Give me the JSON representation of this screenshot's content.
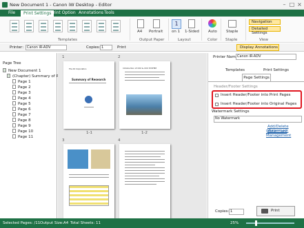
{
  "window": {
    "title": "New Document 1 - Canon iW Desktop - Editor"
  },
  "tabs": [
    "File",
    "Print Settings",
    "Print Option",
    "Annotations",
    "Tools"
  ],
  "ribbon": {
    "templates_label": "Templates",
    "output_paper_label": "Output Paper",
    "layout_label": "Layout",
    "color_label": "Color",
    "staple_label": "Staple",
    "view_label": "View",
    "paper_size": "A4",
    "orientation": "Portrait",
    "pages_per_sheet": "1",
    "on_label": "on 1",
    "sided": "1-Sided",
    "color_mode": "Auto",
    "staple": "Staple",
    "navigation": "Navigation",
    "detailed_settings": "Detailed Settings",
    "display_annotations": "Display Annotations"
  },
  "toolbar": {
    "printer_label": "Printer:",
    "printer_value": "Canon iR-ADV",
    "copies_label": "Copies:",
    "copies_value": "1",
    "print_label": "Print"
  },
  "left": {
    "title": "Page Tree",
    "root": "New Document 1",
    "chapter": "(Chapter) Summary of R",
    "pages": [
      "Page 1",
      "Page 2",
      "Page 3",
      "Page 4",
      "Page 5",
      "Page 6",
      "Page 7",
      "Page 8",
      "Page 9",
      "Page 10",
      "Page 11"
    ]
  },
  "pages": {
    "p1_label": "1-1",
    "p2_label": "1-2",
    "p3_label": "3",
    "p4_label": "4",
    "p1_heading": "Summary of Research",
    "p1_company": "The XX Corporation",
    "p2_heading": "Introduction of XXX & XXX SYSTEM"
  },
  "right": {
    "printer_name_label": "Printer Name:",
    "printer_name_value": "Canon iR-ADV",
    "tabs": [
      "Templates",
      "Print Settings",
      "Page Settings"
    ],
    "header_footer_label": "Header/Footer Settings",
    "insert_print": "Insert Header/Footer into Print Pages",
    "insert_original": "Insert Header/Footer into Original Pages",
    "watermark_label": "Watermark Settings",
    "watermark_value": "No Watermark",
    "add_delete": "Add/Delete Watermark",
    "wm_management": "Watermark Management",
    "copies_label": "Copies:",
    "copies_value": "1",
    "print_button": "Print"
  },
  "status": {
    "selected": "Selected Pages: /11",
    "output_size": "Output Size:A4",
    "total": "Total Sheets: 11",
    "zoom": "25%"
  },
  "colors": {
    "accent": "#1e7145",
    "highlight": "#e0141e"
  }
}
